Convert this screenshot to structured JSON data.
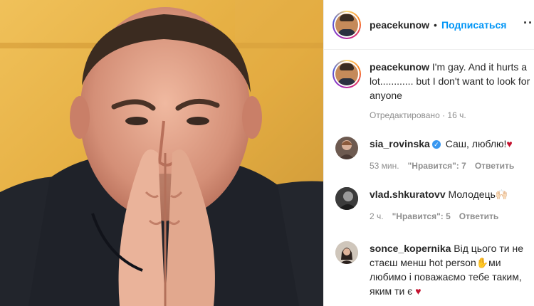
{
  "post": {
    "username": "peacekunow",
    "separator": "•",
    "follow_label": "Подписаться",
    "more_icon": "···"
  },
  "caption": {
    "username": "peacekunow",
    "text": "I'm gay. And it hurts a lot............ but I don't want to look for anyone",
    "meta": "Отредактировано · 16 ч."
  },
  "comments": [
    {
      "username": "sia_rovinska",
      "text": "Саш, люблю!",
      "heart": "♥",
      "time": "53 мин.",
      "likes": "\"Нравится\": 7",
      "reply": "Ответить"
    },
    {
      "username": "vlad.shkuratovv",
      "text": "Молодець🙌🏻",
      "time": "2 ч.",
      "likes": "\"Нравится\": 5",
      "reply": "Ответить"
    },
    {
      "username": "sonce_kopernika",
      "text": "Від цього ти не стаєш менш hot person✋ми любимо і поважаємо тебе таким, яким ти є",
      "heart": "♥"
    }
  ],
  "colors": {
    "accent": "#0095f6",
    "meta": "#8e8e8e",
    "heart": "#c4122f",
    "photo_background": "#d9a23c"
  }
}
